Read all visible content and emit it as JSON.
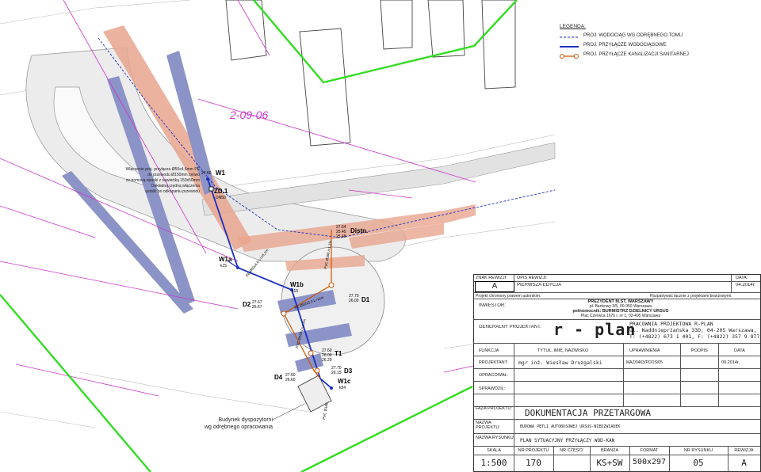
{
  "colors": {
    "boundary_green": "#33dd22",
    "magenta": "#cc33cc",
    "pipe_blue": "#1a2fc0",
    "sewer_orange": "#cc5500",
    "pink_fill": "#e8a58f",
    "slate_fill": "#8c93c7",
    "road_gray": "#dcdcdc"
  },
  "legend": {
    "title": "LEGENDA:",
    "items": [
      {
        "icon": "dashed-blue-line",
        "label": "PROJ. WODOCIĄG WG ODRĘBNEGO TOMU"
      },
      {
        "icon": "solid-blue-line",
        "label": "PROJ. PRZYŁĄCZE WODOCIĄGOWE"
      },
      {
        "icon": "orange-line-with-circles",
        "label": "PROJ. PRZYŁĄCZE KANALIZACJI SANITARNEJ"
      }
    ]
  },
  "map": {
    "parcel_label": "2-09-06",
    "note_connection": [
      "Włączenie proj. przyłącza Ø50x4,6mm PE",
      "do przewodu Ø150mm żeliwo",
      "ze pomocą opaski z nawiertką 150x50mm",
      "Dokładną rzędną włączenia",
      "ustalić po odkopaniu przewodu"
    ],
    "note_building": [
      "Budynek dyspozytorni",
      "wg odrębnego opracowania"
    ],
    "nodes": {
      "w1": {
        "label": "W1",
        "elev": "27.60"
      },
      "zd1": {
        "label": "ZD.1",
        "sub": "DN50"
      },
      "w1a": {
        "label": "W1a",
        "sub": "k15"
      },
      "w1b": {
        "label": "W1b",
        "sub": "k15"
      },
      "w1c": {
        "label": "W1c",
        "sub": "k54"
      },
      "d1": {
        "label": "D1",
        "elev1": "27.70",
        "elev2": "26.00"
      },
      "d2": {
        "label": "D2",
        "elev1": "27.67",
        "elev2": "25.67"
      },
      "d3": {
        "label": "D3",
        "elev1": "27.70",
        "elev2": "26.15"
      },
      "d4": {
        "label": "D4",
        "elev1": "27.60",
        "elev2": "26.60"
      },
      "t1": {
        "label": "T1",
        "elev1": "27.60",
        "elev2": "26.09",
        "elev3": "26.29"
      },
      "distn": {
        "label": "Distn.",
        "elev1": "27.64",
        "elev2": "25.45",
        "elev3": "25.48"
      }
    },
    "pipe_labels": {
      "p1": "PE Ø50x4,6 L=16,1m",
      "p2": "PE Ø32x3,0 L=11m",
      "p3": "PVC Ø160 i=1,1%",
      "p4": "PVC Ø160 L=4,7m",
      "p5": "PVC Ø160"
    }
  },
  "title_block": {
    "rev_header": {
      "znak": "ZNAK REWIZJI:",
      "opis": "OPIS REWIZJI:",
      "data": "DATA:"
    },
    "rev_row": {
      "znak": "A",
      "opis": "PIERWSZA EDYCJA",
      "data": "04.2014r."
    },
    "copyright": "Projekt chroniony prawem autorskim.",
    "copyright_right": "Rozpatrywać łącznie z projektami branżowymi.",
    "investor_label": "INWESTOR:",
    "investor": [
      "PREZYDENT M.ST. WARSZAWY",
      "pl. Bankowy 3/5, 00-950 Warszawa",
      "pełnomocnik: BURMISTRZ DZIELNICY URSUS",
      "Plac Czerwca 1976 r. nr 1, 02-495 Warszawa"
    ],
    "designer_label": "GENERALNY PROJEKTANT:",
    "logo": "r - plan",
    "designer": [
      "PRACOWNIA PROJEKTOWA R-PLAN",
      "ul. Naddnieprżańska 33D, 04-205 Warszawa,",
      "T: (+4822) 673 1 401, F: (+4822) 357 9 877"
    ],
    "team_headers": {
      "funkcja": "FUNKCJA",
      "tytul": "TYTUŁ, IMIĘ, NAZWISKO",
      "upr": "UPRAWNIENIA",
      "podpis": "PODPIS",
      "data": "DATA"
    },
    "team": [
      {
        "funkcja": "PROJEKTANT:",
        "tytul": "mgr inż. Wiesław Druzgalski",
        "upr": "MAZ/0463/POOS/05",
        "data": "09.2014r."
      },
      {
        "funkcja": "OPRACOWAŁ:",
        "tytul": "",
        "upr": "",
        "data": ""
      },
      {
        "funkcja": "SPRAWDZIŁ:",
        "tytul": "",
        "upr": "",
        "data": ""
      }
    ],
    "faza_label": "FAZA PROJEKTU:",
    "faza": "DOKUMENTACJA PRZETARGOWA",
    "nazwa_label": "NAZWA PROJEKTU:",
    "nazwa": "BUDOWA PĘTLI AUTOBUSOWEJ URSUS-NIEDŹWIADEK",
    "rysunek_label": "NAZWA RYSUNKU:",
    "rysunek": "PLAN SYTUACYJNY PRZYŁĄCZY WOD-KAN",
    "bottom_headers": {
      "skala": "SKALA",
      "nr_proj": "NR PROJEKTU",
      "nr_czesci": "NR CZĘŚCI",
      "branza": "BRANŻA",
      "format": "FORMAT",
      "nr_rys": "NR RYSUNKU",
      "rewizja": "REWIZJA"
    },
    "bottom_values": {
      "skala": "1:500",
      "nr_proj": "170",
      "nr_czesci": "",
      "branza": "KS+SW",
      "format": "500x297",
      "nr_rys": "05",
      "rewizja": "A"
    }
  }
}
